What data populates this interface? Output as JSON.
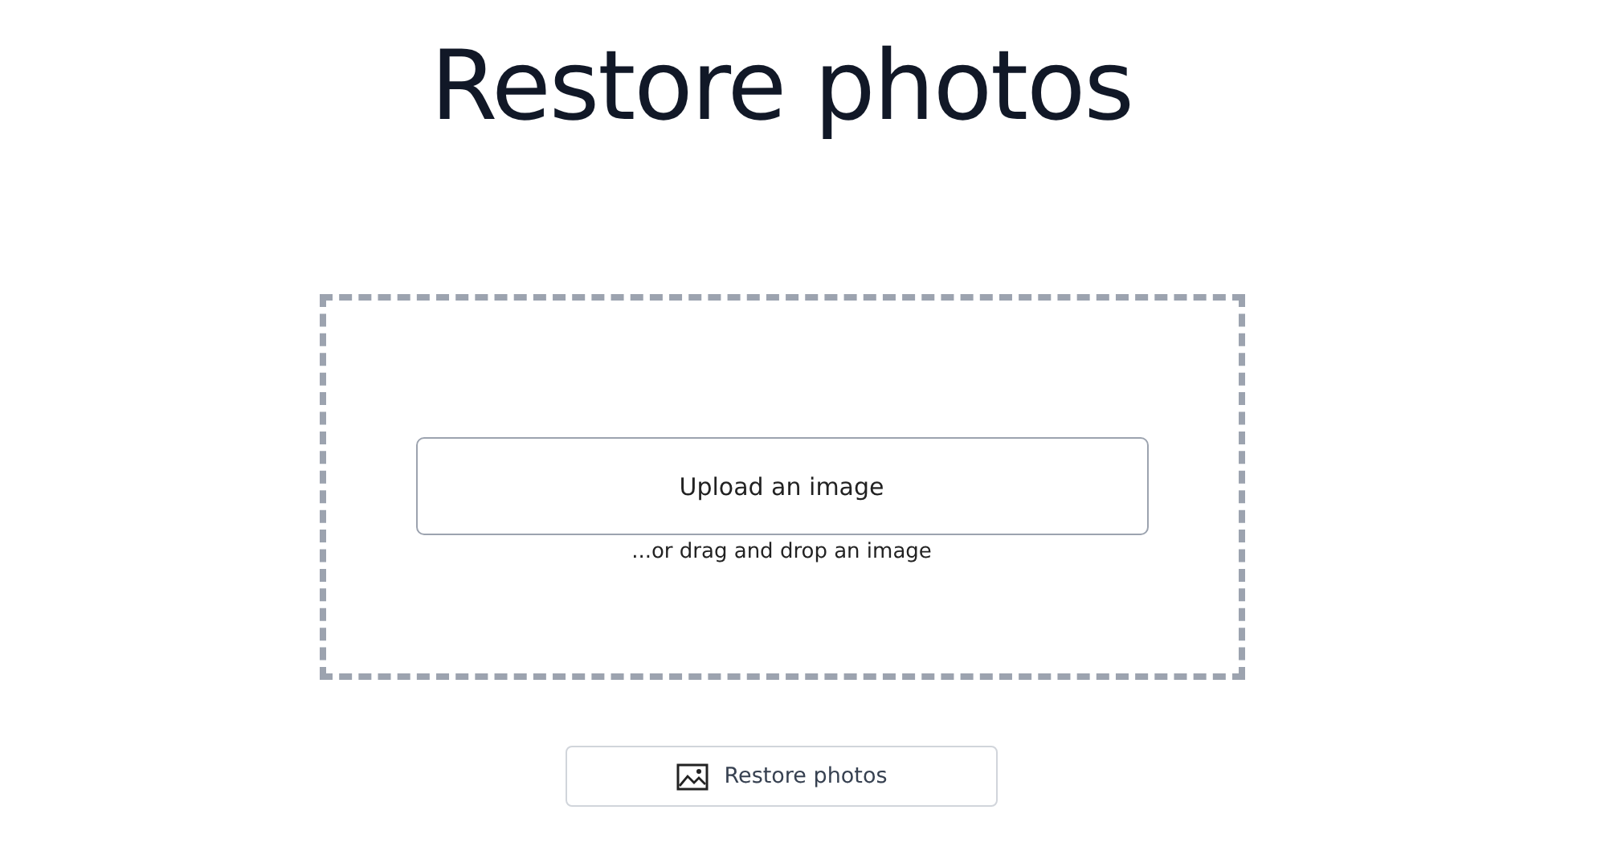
{
  "title": "Restore photos",
  "dropzone": {
    "button": "Upload an image",
    "hint": "...or drag and drop an image"
  },
  "action_button": {
    "label": "Restore photos"
  }
}
